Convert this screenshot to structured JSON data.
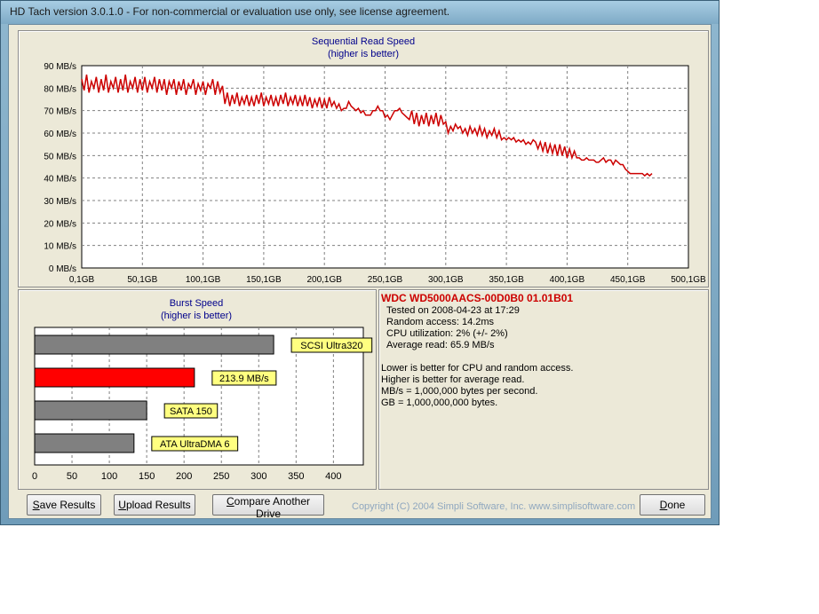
{
  "window": {
    "title": "HD Tach version 3.0.1.0  - For non-commercial or evaluation use only, see license agreement."
  },
  "colors": {
    "series_line": "#cc0000",
    "burst_current": "#ff0000",
    "burst_reference": "#808080",
    "label_box": "#ffff80"
  },
  "chart_data": [
    {
      "type": "line",
      "title": "Sequential Read Speed",
      "subtitle": "(higher is better)",
      "xlabel": "",
      "ylabel": "",
      "ylim": [
        0,
        90
      ],
      "xlim": [
        0,
        500
      ],
      "grid": true,
      "y_ticks": [
        "0 MB/s",
        "10 MB/s",
        "20 MB/s",
        "30 MB/s",
        "40 MB/s",
        "50 MB/s",
        "60 MB/s",
        "70 MB/s",
        "80 MB/s",
        "90 MB/s"
      ],
      "y_tick_values": [
        0,
        10,
        20,
        30,
        40,
        50,
        60,
        70,
        80,
        90
      ],
      "x_ticks": [
        "0,1GB",
        "50,1GB",
        "100,1GB",
        "150,1GB",
        "200,1GB",
        "250,1GB",
        "300,1GB",
        "350,1GB",
        "400,1GB",
        "450,1GB",
        "500,1GB"
      ],
      "x_tick_values": [
        0,
        50,
        100,
        150,
        200,
        250,
        300,
        350,
        400,
        450,
        500
      ],
      "x": [
        0,
        2,
        4,
        6,
        8,
        10,
        12,
        14,
        16,
        18,
        20,
        22,
        24,
        26,
        28,
        30,
        32,
        34,
        36,
        38,
        40,
        42,
        44,
        46,
        48,
        50,
        52,
        54,
        56,
        58,
        60,
        62,
        64,
        66,
        68,
        70,
        72,
        74,
        76,
        78,
        80,
        82,
        84,
        86,
        88,
        90,
        92,
        94,
        96,
        98,
        100,
        102,
        104,
        106,
        108,
        110,
        112,
        114,
        116,
        118,
        120,
        122,
        124,
        126,
        128,
        130,
        132,
        134,
        136,
        138,
        140,
        142,
        144,
        146,
        148,
        150,
        152,
        154,
        156,
        158,
        160,
        162,
        164,
        166,
        168,
        170,
        172,
        174,
        176,
        178,
        180,
        182,
        184,
        186,
        188,
        190,
        192,
        194,
        196,
        198,
        200,
        202,
        204,
        206,
        208,
        210,
        212,
        214,
        216,
        218,
        220,
        222,
        224,
        226,
        228,
        230,
        232,
        234,
        236,
        238,
        240,
        242,
        244,
        246,
        248,
        250,
        252,
        254,
        256,
        258,
        260,
        262,
        264,
        266,
        268,
        270,
        272,
        274,
        276,
        278,
        280,
        282,
        284,
        286,
        288,
        290,
        292,
        294,
        296,
        298,
        300,
        302,
        304,
        306,
        308,
        310,
        312,
        314,
        316,
        318,
        320,
        322,
        324,
        326,
        328,
        330,
        332,
        334,
        336,
        338,
        340,
        342,
        344,
        346,
        348,
        350,
        352,
        354,
        356,
        358,
        360,
        362,
        364,
        366,
        368,
        370,
        372,
        374,
        376,
        378,
        380,
        382,
        384,
        386,
        388,
        390,
        392,
        394,
        396,
        398,
        400,
        402,
        404,
        406,
        408,
        410,
        412,
        414,
        416,
        418,
        420,
        422,
        424,
        426,
        428,
        430,
        432,
        434,
        436,
        438,
        440,
        442,
        444,
        446,
        448,
        450,
        452,
        454,
        456,
        458,
        460,
        462,
        464,
        466,
        468,
        470,
        472,
        474,
        476,
        478,
        480,
        482,
        484,
        486,
        488,
        490,
        492,
        494,
        496,
        498,
        500
      ],
      "series": [
        {
          "values": [
            84,
            79,
            86,
            78,
            83,
            80,
            85,
            78,
            84,
            79,
            86,
            78,
            83,
            80,
            85,
            78,
            84,
            79,
            86,
            78,
            83,
            80,
            85,
            78,
            84,
            79,
            85,
            78,
            83,
            80,
            85,
            78,
            84,
            79,
            84,
            77,
            83,
            80,
            84,
            77,
            83,
            79,
            84,
            77,
            82,
            80,
            84,
            77,
            82,
            79,
            83,
            77,
            82,
            80,
            84,
            77,
            83,
            78,
            81,
            73,
            78,
            72,
            77,
            73,
            78,
            72,
            76,
            73,
            77,
            72,
            76,
            72,
            77,
            73,
            78,
            72,
            76,
            73,
            77,
            72,
            76,
            72,
            77,
            73,
            78,
            72,
            76,
            73,
            77,
            72,
            76,
            72,
            77,
            72,
            76,
            71,
            75,
            72,
            76,
            71,
            75,
            71,
            76,
            72,
            74,
            71,
            73,
            70,
            71,
            71,
            74,
            72,
            71,
            70,
            71,
            69,
            70,
            68,
            68,
            68,
            70,
            70,
            72,
            70,
            70,
            67,
            68,
            66,
            68,
            70,
            70,
            71,
            69,
            68,
            67,
            66,
            70,
            64,
            69,
            63,
            68,
            64,
            69,
            63,
            68,
            64,
            69,
            63,
            68,
            64,
            65,
            60,
            63,
            61,
            64,
            62,
            63,
            60,
            62,
            59,
            63,
            60,
            62,
            59,
            63,
            59,
            62,
            58,
            61,
            59,
            62,
            58,
            61,
            57,
            58,
            57,
            58,
            57,
            58,
            56,
            57,
            56,
            57,
            55,
            56,
            55,
            57,
            56,
            53,
            56,
            52,
            56,
            51,
            55,
            51,
            55,
            50,
            55,
            50,
            54,
            49,
            53,
            49,
            52,
            49,
            49,
            48,
            48,
            49,
            48,
            48,
            48,
            47,
            47,
            48,
            49,
            47,
            48,
            48,
            46,
            48,
            47,
            46,
            46,
            44,
            43,
            42,
            42,
            42,
            42,
            42,
            42,
            41,
            42,
            41,
            42
          ]
        }
      ]
    },
    {
      "type": "bar",
      "orientation": "horizontal",
      "title": "Burst Speed",
      "subtitle": "(higher is better)",
      "xlim": [
        0,
        440
      ],
      "x_ticks": [
        "0",
        "50",
        "100",
        "150",
        "200",
        "250",
        "300",
        "350",
        "400"
      ],
      "x_tick_values": [
        0,
        50,
        100,
        150,
        200,
        250,
        300,
        350,
        400
      ],
      "grid": true,
      "categories": [
        "SCSI Ultra320",
        "213.9 MB/s",
        "SATA 150",
        "ATA UltraDMA 6"
      ],
      "values": [
        320,
        213.9,
        150,
        133
      ]
    }
  ],
  "info": {
    "drive_name": "WDC WD5000AACS-00D0B0 01.01B01",
    "tested_on": "Tested on 2008-04-23 at 17:29",
    "random_access": "Random access: 14.2ms",
    "cpu_utilization": "CPU utilization: 2% (+/- 2%)",
    "average_read": "Average read: 65.9 MB/s",
    "note1": "Lower is better for CPU and random access.",
    "note2": "Higher is better for average read.",
    "note3": "MB/s = 1,000,000 bytes per second.",
    "note4": "GB = 1,000,000,000 bytes."
  },
  "buttons": {
    "save_first": "S",
    "save_rest": "ave Results",
    "upload_first": "U",
    "upload_rest": "pload Results",
    "compare_first": "C",
    "compare_rest": "ompare Another Drive",
    "done_first": "D",
    "done_rest": "one"
  },
  "copyright": "Copyright (C) 2004 Simpli Software, Inc. www.simplisoftware.com"
}
